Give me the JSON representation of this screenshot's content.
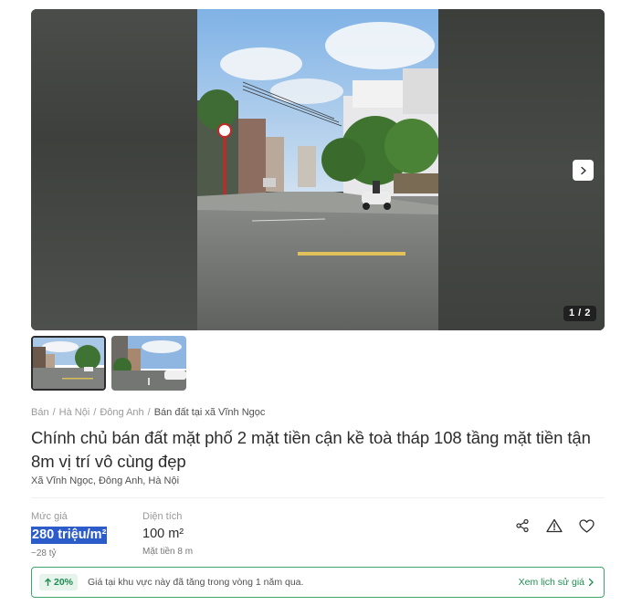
{
  "gallery": {
    "counter": "1 / 2",
    "current_index": 1,
    "total": 2
  },
  "breadcrumb": [
    "Bán",
    "Hà Nội",
    "Đông Anh",
    "Bán đất tại xã Vĩnh Ngọc"
  ],
  "listing": {
    "title": "Chính chủ bán đất mặt phố 2 mặt tiền cận kề toà tháp 108 tầng mặt tiền tận 8m vị trí vô cùng đẹp",
    "address": "Xã Vĩnh Ngọc, Đông Anh, Hà Nội"
  },
  "price": {
    "label": "Mức giá",
    "value": "280 triệu/m²",
    "sub": "~28 tỷ"
  },
  "area": {
    "label": "Diện tích",
    "value": "100 m²",
    "sub": "Mặt tiền 8 m"
  },
  "actions": {
    "icons": [
      "share-icon",
      "report-warning-icon",
      "heart-icon"
    ]
  },
  "trend": {
    "percent": "20%",
    "text": "Giá tại khu vực này đã tăng trong vòng 1 năm qua.",
    "link": "Xem lịch sử giá"
  },
  "colors": {
    "accent_green": "#1e8b4f",
    "price_highlight": "#2b5cc9",
    "text_primary": "#2c2c2c"
  }
}
